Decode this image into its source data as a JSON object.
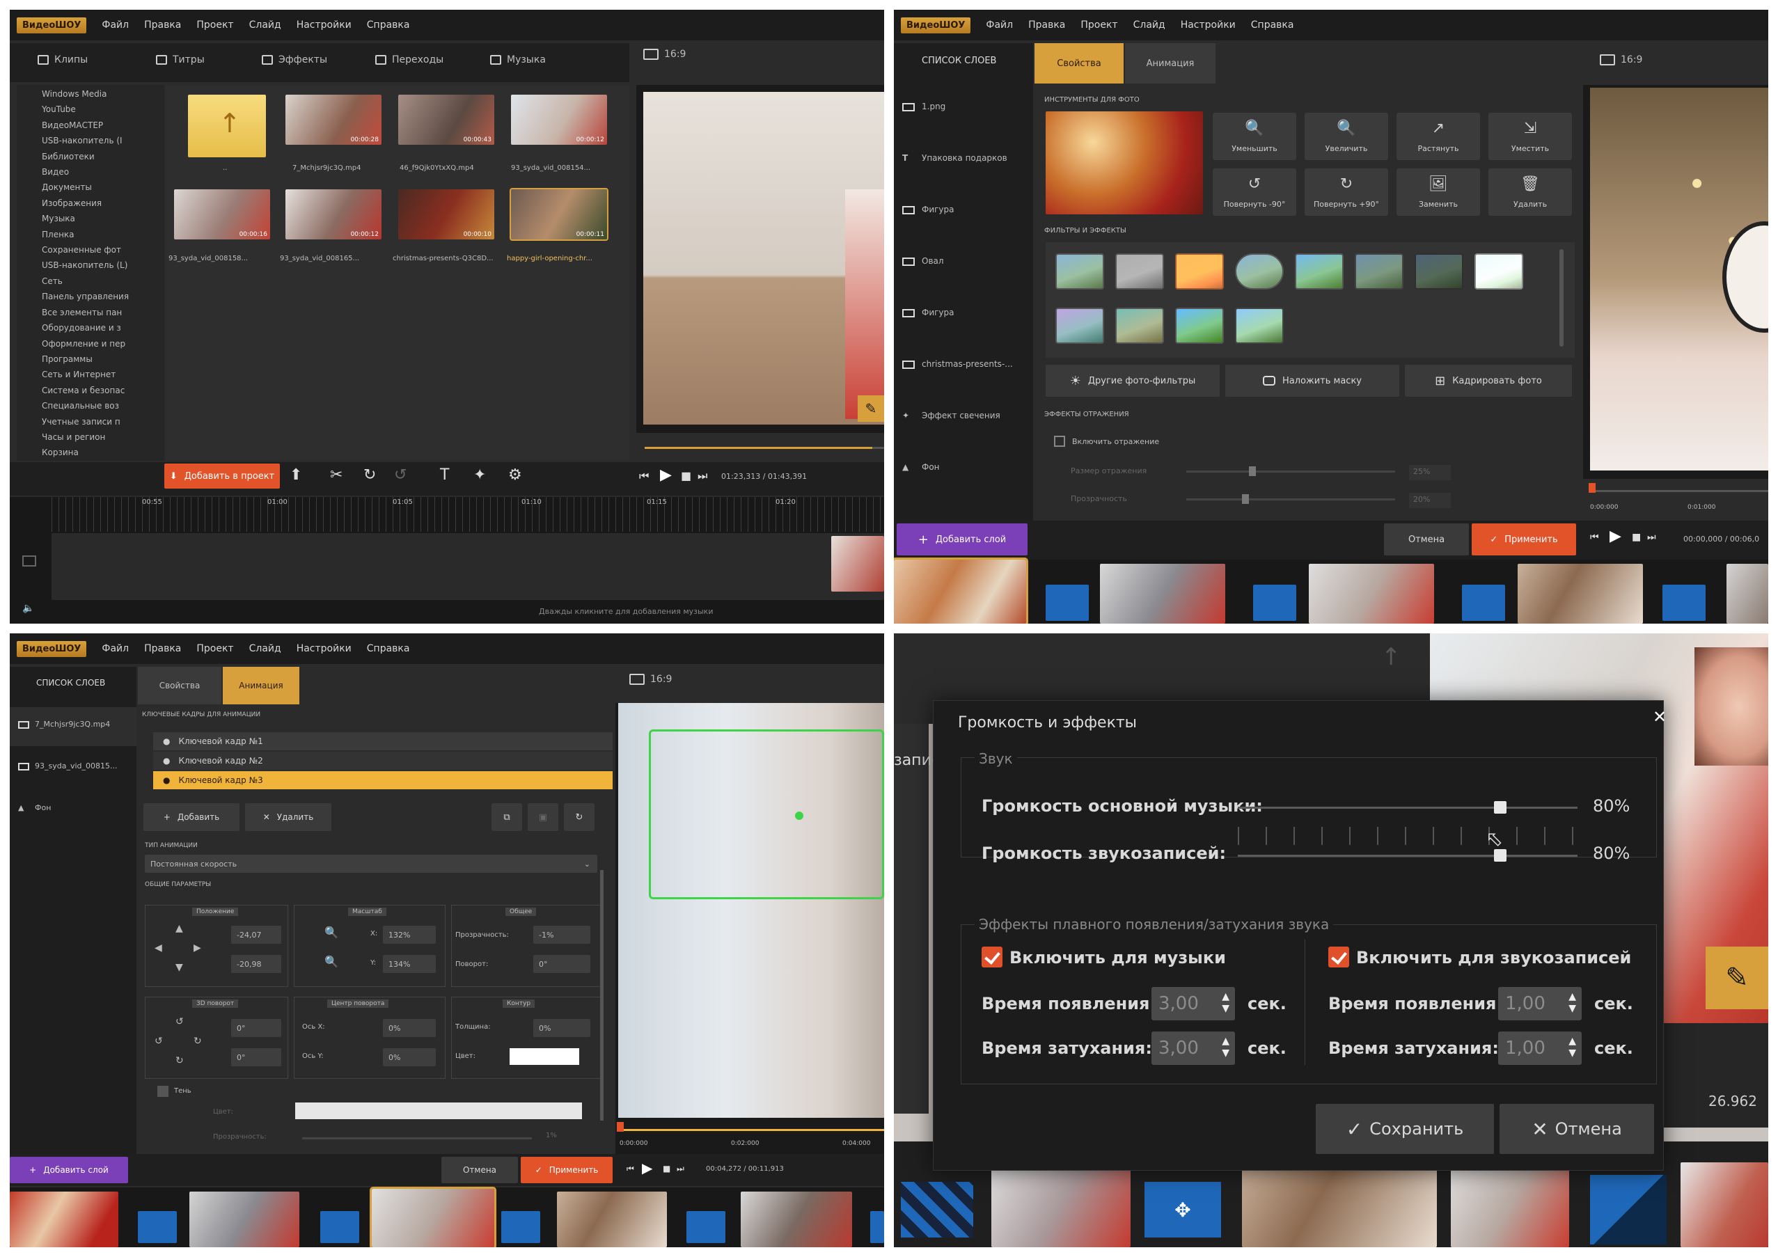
{
  "app": {
    "logo": "ВидеоШОУ",
    "menu": [
      "Файл",
      "Правка",
      "Проект",
      "Слайд",
      "Настройки",
      "Справка"
    ]
  },
  "panel1": {
    "tabs": [
      "Клипы",
      "Титры",
      "Эффекты",
      "Переходы",
      "Музыка"
    ],
    "aspect": "16:9",
    "tree": [
      "Windows Media",
      "YouTube",
      "ВидеоМАСТЕР",
      "USB-накопитель (I",
      "Библиотеки",
      "Видео",
      "Документы",
      "Изображения",
      "Музыка",
      "Пленка",
      "Сохраненные фот",
      "USB-накопитель (L)",
      "Сеть",
      "Панель управления",
      "Все элементы пан",
      "Оборудование и з",
      "Оформление и пер",
      "Программы",
      "Сеть и Интернет",
      "Система и безопас",
      "Специальные воз",
      "Учетные записи п",
      "Часы и регион",
      "Корзина"
    ],
    "files": [
      {
        "name": "..",
        "dur": ""
      },
      {
        "name": "7_Mchjsr9jc3Q.mp4",
        "dur": "00:00:28"
      },
      {
        "name": "46_f9Qjk0YtxXQ.mp4",
        "dur": "00:00:43"
      },
      {
        "name": "93_syda_vid_008154...",
        "dur": "00:00:12"
      },
      {
        "name": "93_syda_vid_008158...",
        "dur": "00:00:16"
      },
      {
        "name": "93_syda_vid_008165...",
        "dur": "00:00:12"
      },
      {
        "name": "christmas-presents-Q3C8D...",
        "dur": "00:00:10"
      },
      {
        "name": "happy-girl-opening-chr...",
        "dur": "00:00:11"
      }
    ],
    "add_button": "Добавить в проект",
    "time_display": "01:23,313 / 01:43,391",
    "ruler": [
      "00:55",
      "01:00",
      "01:05",
      "01:10",
      "01:15",
      "01:20"
    ],
    "footer_hint": "Дважды кликните для добавления музыки"
  },
  "panel2": {
    "layers_title": "СПИСОК СЛОЕВ",
    "tabs": [
      "Свойства",
      "Анимация"
    ],
    "aspect": "16:9",
    "layers": [
      "1.png",
      "Упаковка подарков",
      "Фигура",
      "Овал",
      "Фигура",
      "christmas-presents-...",
      "Эффект свечения",
      "Фон"
    ],
    "tools_title": "ИНСТРУМЕНТЫ ДЛЯ ФОТО",
    "tools": [
      "Уменьшить",
      "Увеличить",
      "Растянуть",
      "Уместить",
      "Повернуть -90°",
      "Повернуть +90°",
      "Заменить",
      "Удалить"
    ],
    "filters_title": "ФИЛЬТРЫ И ЭФФЕКТЫ",
    "filter_buttons": [
      "Другие фото-фильтры",
      "Наложить маску",
      "Кадрировать фото"
    ],
    "reflection_title": "ЭФФЕКТЫ ОТРАЖЕНИЯ",
    "reflection_checkbox": "Включить отражение",
    "reflection_size": "Размер отражения",
    "reflection_size_val": "25%",
    "transparency": "Прозрачность",
    "transparency_val": "20%",
    "add_layer": "Добавить слой",
    "cancel": "Отмена",
    "apply": "Применить",
    "time_display": "00:00,000 / 00:06,0",
    "preview_ruler": [
      "0:00:000",
      "0:01:000"
    ]
  },
  "panel3": {
    "layers_title": "СПИСОК СЛОЕВ",
    "tabs": [
      "Свойства",
      "Анимация"
    ],
    "aspect": "16:9",
    "layers": [
      "7_Mchjsr9jc3Q.mp4",
      "93_syda_vid_00815...",
      "Фон"
    ],
    "keyframes_title": "КЛЮЧЕВЫЕ КАДРЫ ДЛЯ АНИМАЦИИ",
    "keyframes": [
      "Ключевой кадр №1",
      "Ключевой кадр №2",
      "Ключевой кадр №3"
    ],
    "add": "Добавить",
    "remove": "Удалить",
    "anim_type_title": "ТИП АНИМАЦИИ",
    "anim_type": "Постоянная скорость",
    "params_title": "ОБЩИЕ ПАРАМЕТРЫ",
    "group_position": "Положение",
    "group_scale": "Масштаб",
    "group_general": "Общее",
    "pos_x": "-24,07",
    "pos_y": "-20,98",
    "scale_x_label": "X:",
    "scale_x": "132%",
    "scale_y_label": "Y:",
    "scale_y": "134%",
    "opacity_label": "Прозрачность:",
    "opacity": "-1%",
    "rotate_label": "Поворот:",
    "rotate": "0°",
    "group_3d": "3D поворот",
    "group_center": "Центр поворота",
    "group_outline": "Контур",
    "r3d_a": "0°",
    "r3d_b": "0°",
    "axis_x_label": "Ось X:",
    "axis_x": "0%",
    "axis_y_label": "Ось Y:",
    "axis_y": "0%",
    "thickness_label": "Толщина:",
    "thickness": "0%",
    "color_label": "Цвет:",
    "shadow": "Тень",
    "shadow_color": "Цвет:",
    "shadow_opacity": "Прозрачность:",
    "shadow_opacity_val": "1%",
    "add_layer": "Добавить слой",
    "cancel": "Отмена",
    "apply": "Применить",
    "time_display": "00:04,272 / 00:11,913",
    "preview_ruler": [
      "0:00:000",
      "0:02:000",
      "0:04:000"
    ]
  },
  "panel4": {
    "dialog_title": "Громкость и эффекты",
    "sound_group": "Звук",
    "music_volume_label": "Громкость основной музыки:",
    "music_volume": "80%",
    "voice_volume_label": "Громкость звукозаписей:",
    "voice_volume": "80%",
    "fade_group": "Эффекты плавного появления/затухания звука",
    "music_enable": "Включить для музыки",
    "voice_enable": "Включить для звукозаписей",
    "appear_label": "Время появления:",
    "fade_label": "Время затухания:",
    "music_appear": "3,00",
    "music_fade": "3,00",
    "voice_appear": "1,00",
    "voice_fade": "1,00",
    "unit": "сек.",
    "save": "Сохранить",
    "cancel": "Отмена",
    "bg_partial_label": "записа",
    "bg_time": "26.962"
  },
  "colors": {
    "accent": "#d8a03c",
    "apply_red": "#e2532a",
    "add_purple": "#7b3fb8",
    "transition_blue": "#1f67b8",
    "highlight_row": "#f0b43a"
  },
  "levels": {
    "music_volume": 0.8,
    "voice_volume": 0.8
  }
}
